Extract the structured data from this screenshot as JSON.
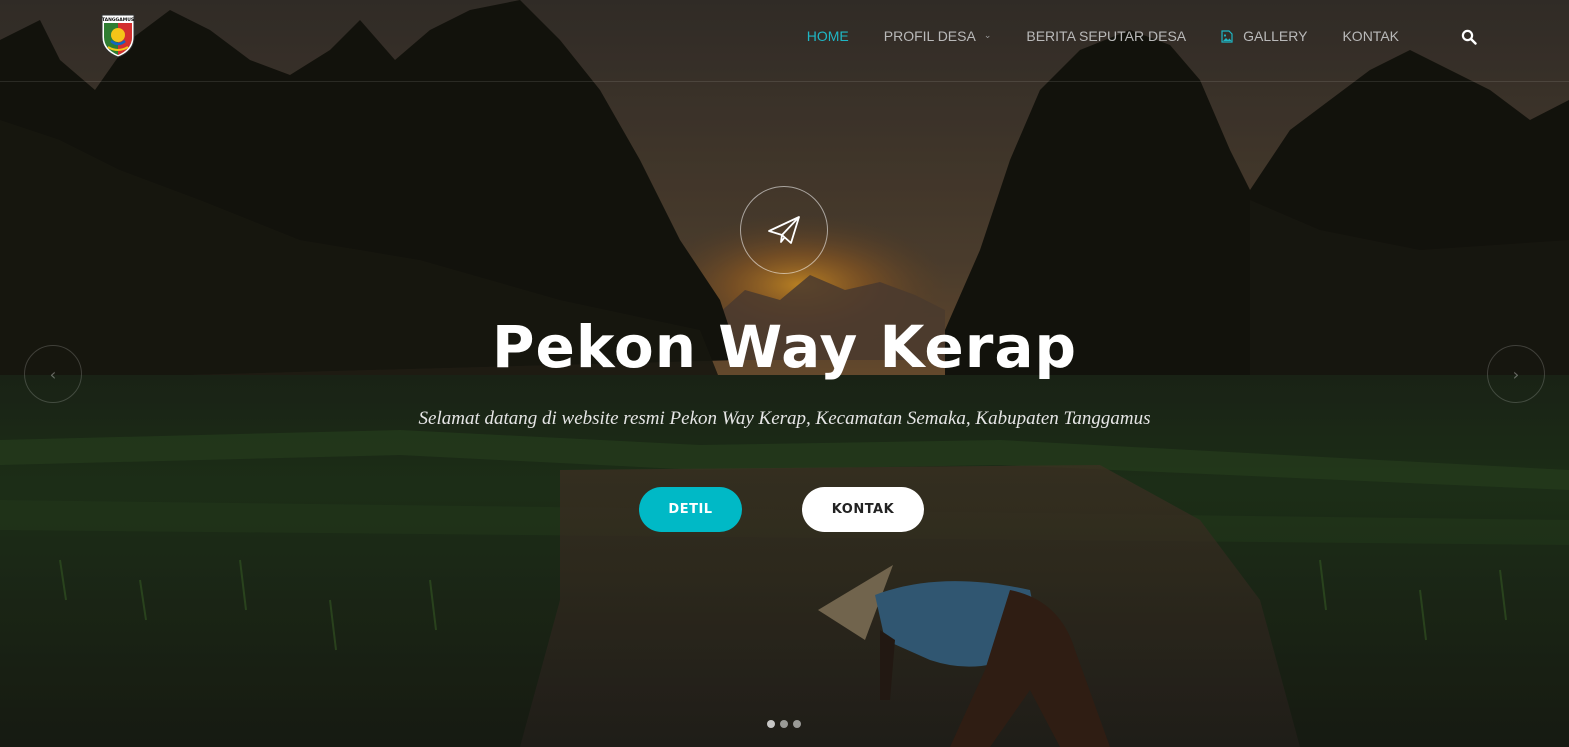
{
  "brand": {
    "logo_icon": "tanggamus-shield-logo",
    "logo_text": "TANGGAMUS"
  },
  "nav": {
    "items": [
      {
        "label": "HOME",
        "active": true
      },
      {
        "label": "PROFIL DESA",
        "has_dropdown": true
      },
      {
        "label": "BERITA SEPUTAR DESA"
      },
      {
        "label": "GALLERY",
        "icon": "image-icon"
      },
      {
        "label": "KONTAK"
      }
    ],
    "search_icon": "search-icon"
  },
  "hero": {
    "icon": "paper-plane-icon",
    "title": "Pekon Way Kerap",
    "subtitle": "Selamat datang di website resmi Pekon Way Kerap, Kecamatan Semaka, Kabupaten Tanggamus",
    "primary_button": "DETIL",
    "secondary_button": "KONTAK"
  },
  "carousel": {
    "prev_icon": "chevron-left-icon",
    "next_icon": "chevron-right-icon",
    "prev_glyph": "‹",
    "next_glyph": "›",
    "slide_count": 3,
    "active_slide": 1
  },
  "colors": {
    "accent": "#00b9c6",
    "nav_active": "#1fb6c4",
    "nav_text": "#b9b9b9"
  }
}
